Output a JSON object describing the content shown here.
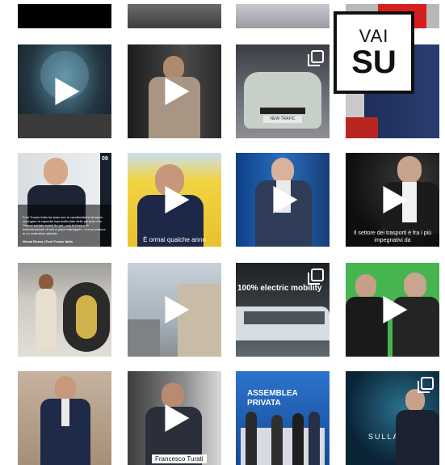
{
  "back_to_top": {
    "line1": "VAI",
    "line2": "SU"
  },
  "posts": [
    {
      "id": "r0c0",
      "video": false,
      "multi": false
    },
    {
      "id": "r0c1",
      "video": false,
      "multi": false
    },
    {
      "id": "r0c2",
      "video": false,
      "multi": false
    },
    {
      "id": "r0c3",
      "video": false,
      "multi": false
    },
    {
      "id": "r1c0",
      "video": true,
      "multi": false
    },
    {
      "id": "r1c1",
      "video": true,
      "multi": false
    },
    {
      "id": "r1c2",
      "video": false,
      "multi": true,
      "logo_text": "NEW TRAFIC"
    },
    {
      "id": "r1c3",
      "video": false,
      "multi": false
    },
    {
      "id": "r2c0",
      "video": false,
      "multi": false,
      "badge": "09",
      "caption": "Ford Trucks Italia ha stato sue le caratteristiche di saper coniugare la capacità imprenditoriale delle persone che l'hanno portata avanti fin qui - con la forza e la determinazione di veri e propri startupper - con la potenza di un costruttore globale",
      "credit": "Nicola Russo | Ford Trucks Italia"
    },
    {
      "id": "r2c1",
      "video": true,
      "multi": false,
      "caption": "È ormai qualche anno"
    },
    {
      "id": "r2c2",
      "video": true,
      "multi": false
    },
    {
      "id": "r2c3",
      "video": true,
      "multi": false,
      "caption": "Il settore dei trasporti è fra i più impegnativi da"
    },
    {
      "id": "r3c0",
      "video": false,
      "multi": false
    },
    {
      "id": "r3c1",
      "video": true,
      "multi": false
    },
    {
      "id": "r3c2",
      "video": false,
      "multi": true,
      "banner": "100% electric mobility"
    },
    {
      "id": "r3c3",
      "video": true,
      "multi": false
    },
    {
      "id": "r4c0",
      "video": false,
      "multi": false
    },
    {
      "id": "r4c1",
      "video": true,
      "multi": false,
      "name_tag": "Francesco Turati"
    },
    {
      "id": "r4c2",
      "video": false,
      "multi": false,
      "banner": "ASSEMBLEA PRIVATA"
    },
    {
      "id": "r4c3",
      "video": false,
      "multi": true,
      "banner": "SULLA"
    }
  ]
}
